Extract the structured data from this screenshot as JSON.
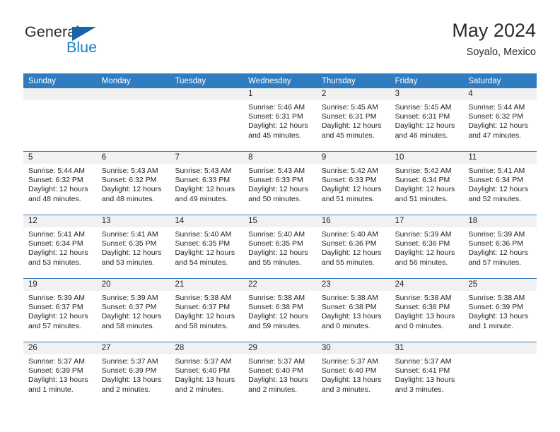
{
  "brand": {
    "name_top": "General",
    "name_bottom": "Blue",
    "accent_color": "#1a7fc1",
    "triangle_color": "#1565a8"
  },
  "header": {
    "title": "May 2024",
    "subtitle": "Soyalo, Mexico"
  },
  "calendar": {
    "header_bg": "#2f7cc0",
    "header_text_color": "#ffffff",
    "day_band_bg": "#f1f1f1",
    "weekdays": [
      "Sunday",
      "Monday",
      "Tuesday",
      "Wednesday",
      "Thursday",
      "Friday",
      "Saturday"
    ],
    "weeks": [
      [
        {
          "day": "",
          "empty": true
        },
        {
          "day": "",
          "empty": true
        },
        {
          "day": "",
          "empty": true
        },
        {
          "day": "1",
          "sunrise": "Sunrise: 5:46 AM",
          "sunset": "Sunset: 6:31 PM",
          "daylight": "Daylight: 12 hours and 45 minutes."
        },
        {
          "day": "2",
          "sunrise": "Sunrise: 5:45 AM",
          "sunset": "Sunset: 6:31 PM",
          "daylight": "Daylight: 12 hours and 45 minutes."
        },
        {
          "day": "3",
          "sunrise": "Sunrise: 5:45 AM",
          "sunset": "Sunset: 6:31 PM",
          "daylight": "Daylight: 12 hours and 46 minutes."
        },
        {
          "day": "4",
          "sunrise": "Sunrise: 5:44 AM",
          "sunset": "Sunset: 6:32 PM",
          "daylight": "Daylight: 12 hours and 47 minutes."
        }
      ],
      [
        {
          "day": "5",
          "sunrise": "Sunrise: 5:44 AM",
          "sunset": "Sunset: 6:32 PM",
          "daylight": "Daylight: 12 hours and 48 minutes."
        },
        {
          "day": "6",
          "sunrise": "Sunrise: 5:43 AM",
          "sunset": "Sunset: 6:32 PM",
          "daylight": "Daylight: 12 hours and 48 minutes."
        },
        {
          "day": "7",
          "sunrise": "Sunrise: 5:43 AM",
          "sunset": "Sunset: 6:33 PM",
          "daylight": "Daylight: 12 hours and 49 minutes."
        },
        {
          "day": "8",
          "sunrise": "Sunrise: 5:43 AM",
          "sunset": "Sunset: 6:33 PM",
          "daylight": "Daylight: 12 hours and 50 minutes."
        },
        {
          "day": "9",
          "sunrise": "Sunrise: 5:42 AM",
          "sunset": "Sunset: 6:33 PM",
          "daylight": "Daylight: 12 hours and 51 minutes."
        },
        {
          "day": "10",
          "sunrise": "Sunrise: 5:42 AM",
          "sunset": "Sunset: 6:34 PM",
          "daylight": "Daylight: 12 hours and 51 minutes."
        },
        {
          "day": "11",
          "sunrise": "Sunrise: 5:41 AM",
          "sunset": "Sunset: 6:34 PM",
          "daylight": "Daylight: 12 hours and 52 minutes."
        }
      ],
      [
        {
          "day": "12",
          "sunrise": "Sunrise: 5:41 AM",
          "sunset": "Sunset: 6:34 PM",
          "daylight": "Daylight: 12 hours and 53 minutes."
        },
        {
          "day": "13",
          "sunrise": "Sunrise: 5:41 AM",
          "sunset": "Sunset: 6:35 PM",
          "daylight": "Daylight: 12 hours and 53 minutes."
        },
        {
          "day": "14",
          "sunrise": "Sunrise: 5:40 AM",
          "sunset": "Sunset: 6:35 PM",
          "daylight": "Daylight: 12 hours and 54 minutes."
        },
        {
          "day": "15",
          "sunrise": "Sunrise: 5:40 AM",
          "sunset": "Sunset: 6:35 PM",
          "daylight": "Daylight: 12 hours and 55 minutes."
        },
        {
          "day": "16",
          "sunrise": "Sunrise: 5:40 AM",
          "sunset": "Sunset: 6:36 PM",
          "daylight": "Daylight: 12 hours and 55 minutes."
        },
        {
          "day": "17",
          "sunrise": "Sunrise: 5:39 AM",
          "sunset": "Sunset: 6:36 PM",
          "daylight": "Daylight: 12 hours and 56 minutes."
        },
        {
          "day": "18",
          "sunrise": "Sunrise: 5:39 AM",
          "sunset": "Sunset: 6:36 PM",
          "daylight": "Daylight: 12 hours and 57 minutes."
        }
      ],
      [
        {
          "day": "19",
          "sunrise": "Sunrise: 5:39 AM",
          "sunset": "Sunset: 6:37 PM",
          "daylight": "Daylight: 12 hours and 57 minutes."
        },
        {
          "day": "20",
          "sunrise": "Sunrise: 5:39 AM",
          "sunset": "Sunset: 6:37 PM",
          "daylight": "Daylight: 12 hours and 58 minutes."
        },
        {
          "day": "21",
          "sunrise": "Sunrise: 5:38 AM",
          "sunset": "Sunset: 6:37 PM",
          "daylight": "Daylight: 12 hours and 58 minutes."
        },
        {
          "day": "22",
          "sunrise": "Sunrise: 5:38 AM",
          "sunset": "Sunset: 6:38 PM",
          "daylight": "Daylight: 12 hours and 59 minutes."
        },
        {
          "day": "23",
          "sunrise": "Sunrise: 5:38 AM",
          "sunset": "Sunset: 6:38 PM",
          "daylight": "Daylight: 13 hours and 0 minutes."
        },
        {
          "day": "24",
          "sunrise": "Sunrise: 5:38 AM",
          "sunset": "Sunset: 6:38 PM",
          "daylight": "Daylight: 13 hours and 0 minutes."
        },
        {
          "day": "25",
          "sunrise": "Sunrise: 5:38 AM",
          "sunset": "Sunset: 6:39 PM",
          "daylight": "Daylight: 13 hours and 1 minute."
        }
      ],
      [
        {
          "day": "26",
          "sunrise": "Sunrise: 5:37 AM",
          "sunset": "Sunset: 6:39 PM",
          "daylight": "Daylight: 13 hours and 1 minute."
        },
        {
          "day": "27",
          "sunrise": "Sunrise: 5:37 AM",
          "sunset": "Sunset: 6:39 PM",
          "daylight": "Daylight: 13 hours and 2 minutes."
        },
        {
          "day": "28",
          "sunrise": "Sunrise: 5:37 AM",
          "sunset": "Sunset: 6:40 PM",
          "daylight": "Daylight: 13 hours and 2 minutes."
        },
        {
          "day": "29",
          "sunrise": "Sunrise: 5:37 AM",
          "sunset": "Sunset: 6:40 PM",
          "daylight": "Daylight: 13 hours and 2 minutes."
        },
        {
          "day": "30",
          "sunrise": "Sunrise: 5:37 AM",
          "sunset": "Sunset: 6:40 PM",
          "daylight": "Daylight: 13 hours and 3 minutes."
        },
        {
          "day": "31",
          "sunrise": "Sunrise: 5:37 AM",
          "sunset": "Sunset: 6:41 PM",
          "daylight": "Daylight: 13 hours and 3 minutes."
        },
        {
          "day": "",
          "empty": true
        }
      ]
    ]
  }
}
